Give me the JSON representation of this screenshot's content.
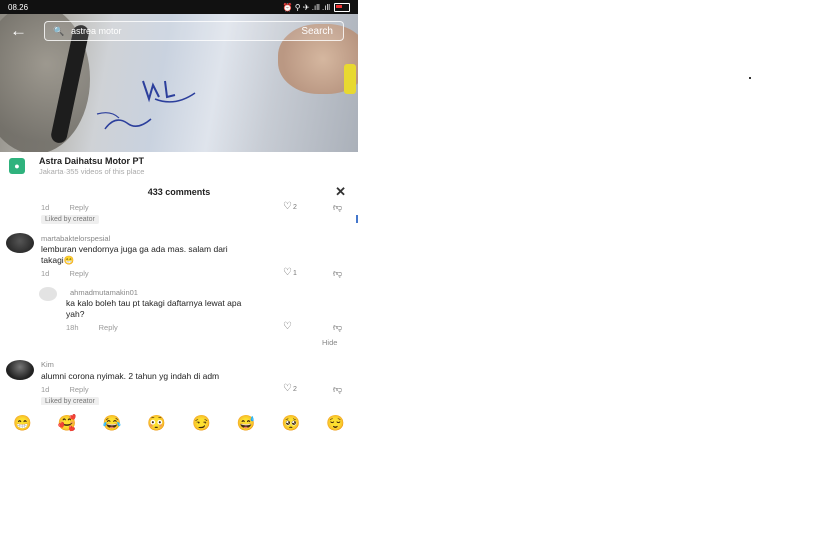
{
  "status": {
    "time": "08.26",
    "icons": "⏰ ⚲ ✈ .ıll .ıll"
  },
  "search": {
    "query": "astrea motor",
    "button": "Search",
    "back": "←",
    "icon": "🔍"
  },
  "place": {
    "name": "Astra Daihatsu Motor PT",
    "subtitle": "Jakarta·355 videos of this place"
  },
  "comments": {
    "count_label": "433 comments",
    "close": "✕",
    "top": {
      "age": "1d",
      "reply": "Reply",
      "likes": "2",
      "liked": "Liked by creator"
    },
    "c1": {
      "user": "martabaktelorspesial",
      "text1": "lemburan vendornya juga ga ada mas. salam dari",
      "text2": "takagi😁",
      "age": "1d",
      "reply": "Reply",
      "likes": "1"
    },
    "c2": {
      "user": "ahmadmutamakin01",
      "text1": "ka kalo boleh tau pt takagi daftarnya lewat apa",
      "text2": "yah?",
      "age": "18h",
      "reply": "Reply",
      "hide": "Hide"
    },
    "c3": {
      "user": "Kim",
      "text": "alumni corona nyimak. 2 tahun yg indah di adm",
      "age": "1d",
      "reply": "Reply",
      "likes": "2",
      "liked": "Liked by creator"
    }
  },
  "emojis": [
    "😁",
    "🥰",
    "😂",
    "😳",
    "😏",
    "😅",
    "🥺",
    "😌"
  ]
}
